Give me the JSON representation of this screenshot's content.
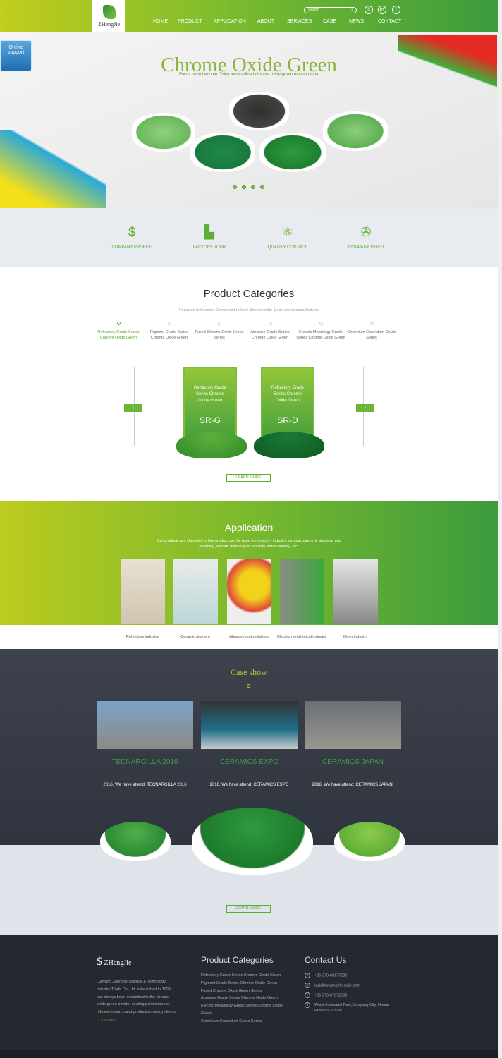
{
  "header": {
    "logo_text": "ZHengJie",
    "search_placeholder": "Search",
    "nav": [
      "HOME",
      "PRODUCT",
      "APPLICATION",
      "ABOUT",
      "SERVICES",
      "CASE",
      "NEWS",
      "CONTACT"
    ],
    "social_icons": [
      "skype-icon",
      "google-plus-icon",
      "facebook-icon"
    ]
  },
  "online_support": "Online support",
  "hero": {
    "title": "Chrome Oxide Green",
    "subtitle": "Focus on to become China most refined chrome oxide green manufacturer",
    "slides": 4,
    "active_slide": 1
  },
  "features": [
    {
      "label": "COMPANY PROFILE",
      "icon": "logo-s-icon"
    },
    {
      "label": "FACTORY TOUR",
      "icon": "factory-icon"
    },
    {
      "label": "QUALITY CONTROL",
      "icon": "atom-icon"
    },
    {
      "label": "COMPANY VIDEO",
      "icon": "film-reel-icon"
    }
  ],
  "product_categories": {
    "title": "Product Categories",
    "subtitle": "Focus on to become China most refined chrome oxide green series manufacturer",
    "tabs": [
      "Refractory Grade Series Chrome Oxide Green",
      "Pigment Grade Series Chrome Oxide Green",
      "Fused Chrome Oxide Green Series",
      "Abrasive Grade Series Chrome Oxide Green",
      "Electric Metallurgy Grade Series Chrome Oxide Green",
      "Chromium Corundum Grade Series"
    ],
    "active_tab": 0,
    "cards": [
      {
        "title": "Refractory Grade Series Chrome Oxide Green",
        "code": "SR-G"
      },
      {
        "title": "Refractory Grade Series Chrome Oxide Green",
        "code": "SR-D"
      }
    ],
    "learn_more": "LEARN MORE"
  },
  "application": {
    "title": "Application",
    "description": "Our products are classified in five grades, can be used in refractory industry, ceramic pigment, abrasive and polishing, electric metallugical industry, other industry, etc.",
    "items": [
      "Refractory industry",
      "Ceramic pigment",
      "Abrasive and polishing",
      "Electric metallugical industry",
      "Other industry"
    ]
  },
  "case_show": {
    "title": "Case show",
    "items": [
      {
        "title": "TECNARGILLA 2016",
        "desc": "2016, We have attend: TECNARGILLA 2016"
      },
      {
        "title": "CERAMICS EXPO",
        "desc": "2016, We have attend: CERAMICS EXPO"
      },
      {
        "title": "CERAMICS JAPAN",
        "desc": "2016, We have attend: CERAMICS JAPAN;"
      }
    ],
    "learn_more": "LEARN MORE"
  },
  "footer": {
    "logo_text": "ZHengJie",
    "about": "Luoyang Zhengjie Science &Technology Industry Trade Co.,Ltd. established in 1999, has always been committed to the chrome oxide green powder coating paint series of refined research and production satisfy clients ...",
    "more": "< more >",
    "categories_title": "Product Categories",
    "categories": [
      "Refractory Grade Series Chrome Oxide Green",
      "Pigment Grade Series Chrome Oxide Green",
      "Fused Chrome Oxide Green Series",
      "Abrasive Grade Series Chrome Oxide Green",
      "Electric Metallurgy Grade Series Chrome Oxide Green",
      "Chromium Corundum Grade Series"
    ],
    "contact_title": "Contact Us",
    "contact": [
      {
        "icon": "phone-icon",
        "text": "+86 379-63177236"
      },
      {
        "icon": "email-icon",
        "text": "lyzj@luoyangzhengjie.com"
      },
      {
        "icon": "fax-icon",
        "text": "+86 379-67872933"
      },
      {
        "icon": "location-icon",
        "text": "Weipo Industrial Park, Luoyang City, Henan Province, China"
      }
    ]
  },
  "colors": {
    "brand_green": "#5bae2f",
    "header_start": "#c2cd1c",
    "header_end": "#3b9b3d",
    "footer_bg": "#242831"
  }
}
